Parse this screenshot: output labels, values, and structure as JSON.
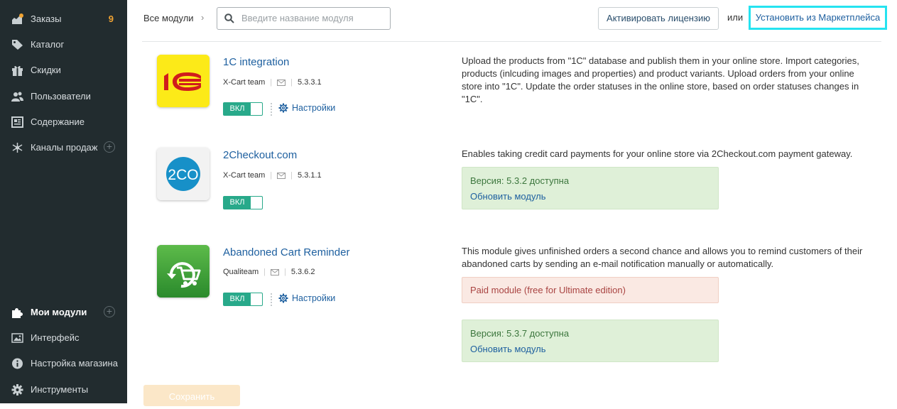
{
  "sidebar": {
    "items": [
      {
        "label": "Заказы",
        "icon": "orders-icon",
        "badge": "9"
      },
      {
        "label": "Каталог",
        "icon": "tag-icon"
      },
      {
        "label": "Скидки",
        "icon": "gift-icon"
      },
      {
        "label": "Пользователи",
        "icon": "users-icon"
      },
      {
        "label": "Содержание",
        "icon": "content-icon"
      },
      {
        "label": "Каналы продаж",
        "icon": "network-icon"
      },
      {
        "label": "Мои модули",
        "icon": "puzzle-icon"
      },
      {
        "label": "Интерфейс",
        "icon": "image-icon"
      },
      {
        "label": "Настройка магазина",
        "icon": "info-icon"
      },
      {
        "label": "Инструменты",
        "icon": "gear-icon"
      }
    ],
    "plus_symbol": "+"
  },
  "header": {
    "breadcrumb": "Все модули",
    "breadcrumb_chevron": "›",
    "search_placeholder": "Введите название модуля",
    "activate_license": "Активировать лицензию",
    "or": "или",
    "install_marketplace": "Установить из Маркетплейса"
  },
  "modules": [
    {
      "name": "1C integration",
      "author": "X-Cart team",
      "version": "5.3.3.1",
      "toggle": "ВКЛ",
      "settings": "Настройки",
      "logo_text": "1С",
      "description": "Upload the products from \"1C\" database and publish them in your online store. Import categories, products (inlcuding images and properties) and product variants. Upload orders from your online store into \"1C\". Update the order statuses in the online store, based on order statuses changes in \"1C\"."
    },
    {
      "name": "2Checkout.com",
      "author": "X-Cart team",
      "version": "5.3.1.1",
      "toggle": "ВКЛ",
      "logo_text": "2CO",
      "description": "Enables taking credit card payments for your online store via 2Checkout.com payment gateway.",
      "update_available": "Версия: 5.3.2 доступна",
      "update_link": "Обновить модуль"
    },
    {
      "name": "Abandoned Cart Reminder",
      "author": "Qualiteam",
      "version": "5.3.6.2",
      "toggle": "ВКЛ",
      "settings": "Настройки",
      "description": "This module gives unfinished orders a second chance and allows you to remind customers of their abandoned carts by sending an e-mail notification manually or automatically.",
      "paid_notice": "Paid module (free for Ultimate edition)",
      "update_available": "Версия: 5.3.7 доступна",
      "update_link": "Обновить модуль"
    }
  ],
  "footer": {
    "save_label": "Сохранить"
  },
  "colors": {
    "sidebar_bg": "#222c2f",
    "accent_link": "#1d5f9f",
    "toggle_green": "#28a98a",
    "badge_orange": "#f0a332",
    "highlight_cyan": "#25e3f0"
  }
}
